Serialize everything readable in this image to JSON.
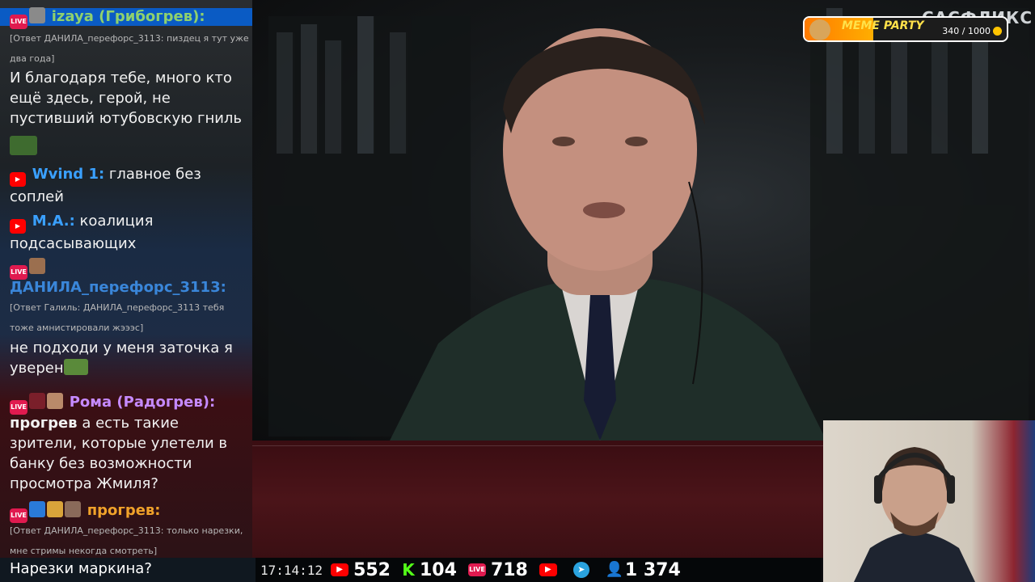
{
  "chat": {
    "messages": [
      {
        "nick": "izaya (Грибогрев):",
        "nick_color": "#8fd16e",
        "reply": "[Ответ ДАНИЛА_перефорс_3113: пиздец я тут уже два года]",
        "text": "И благодаря тебе, много кто ещё здесь, герой, не пустивший ютубовскую гниль"
      },
      {
        "nick": "Wvind 1:",
        "nick_color": "#3aa0ff",
        "text": "главное без соплей"
      },
      {
        "nick": "M.A.:",
        "nick_color": "#3aa0ff",
        "text": "коалиция подсасывающих"
      },
      {
        "nick": "ДАНИЛА_перефорс_3113:",
        "nick_color": "#3a86d9",
        "reply": "[Ответ Галиль: ДАНИЛА_перефорс_3113 тебя тоже амнистировали жэээс]",
        "text": "не подходи у меня заточка я уверен"
      },
      {
        "nick": "Рома (Радогрев):",
        "nick_color": "#c58aff",
        "text_bold": "прогрев",
        "text": "а есть такие зрители, которые улетели в банку без возможности просмотра Жмиля?"
      },
      {
        "nick": "прогрев:",
        "nick_color": "#f0a22a",
        "reply": "[Ответ ДАНИЛА_перефорс_3113: только нарезки, мне стримы некогда смотреть]"
      }
    ],
    "bottom_text": "Нарезки маркина?"
  },
  "stats": {
    "time": "17:14:12",
    "youtube": "552",
    "kick": "104",
    "vk": "718",
    "viewers": "1 374",
    "live_label": "LIVE"
  },
  "widget": {
    "title": "MEME PARTY",
    "progress_text": "340 / 1000",
    "progress_fraction": 0.34,
    "brand": "САСФЛИКС"
  },
  "colors": {
    "accent_live": "#e01a4f",
    "youtube": "#ff0000",
    "kick": "#53fc18",
    "telegram": "#2aa3df"
  }
}
